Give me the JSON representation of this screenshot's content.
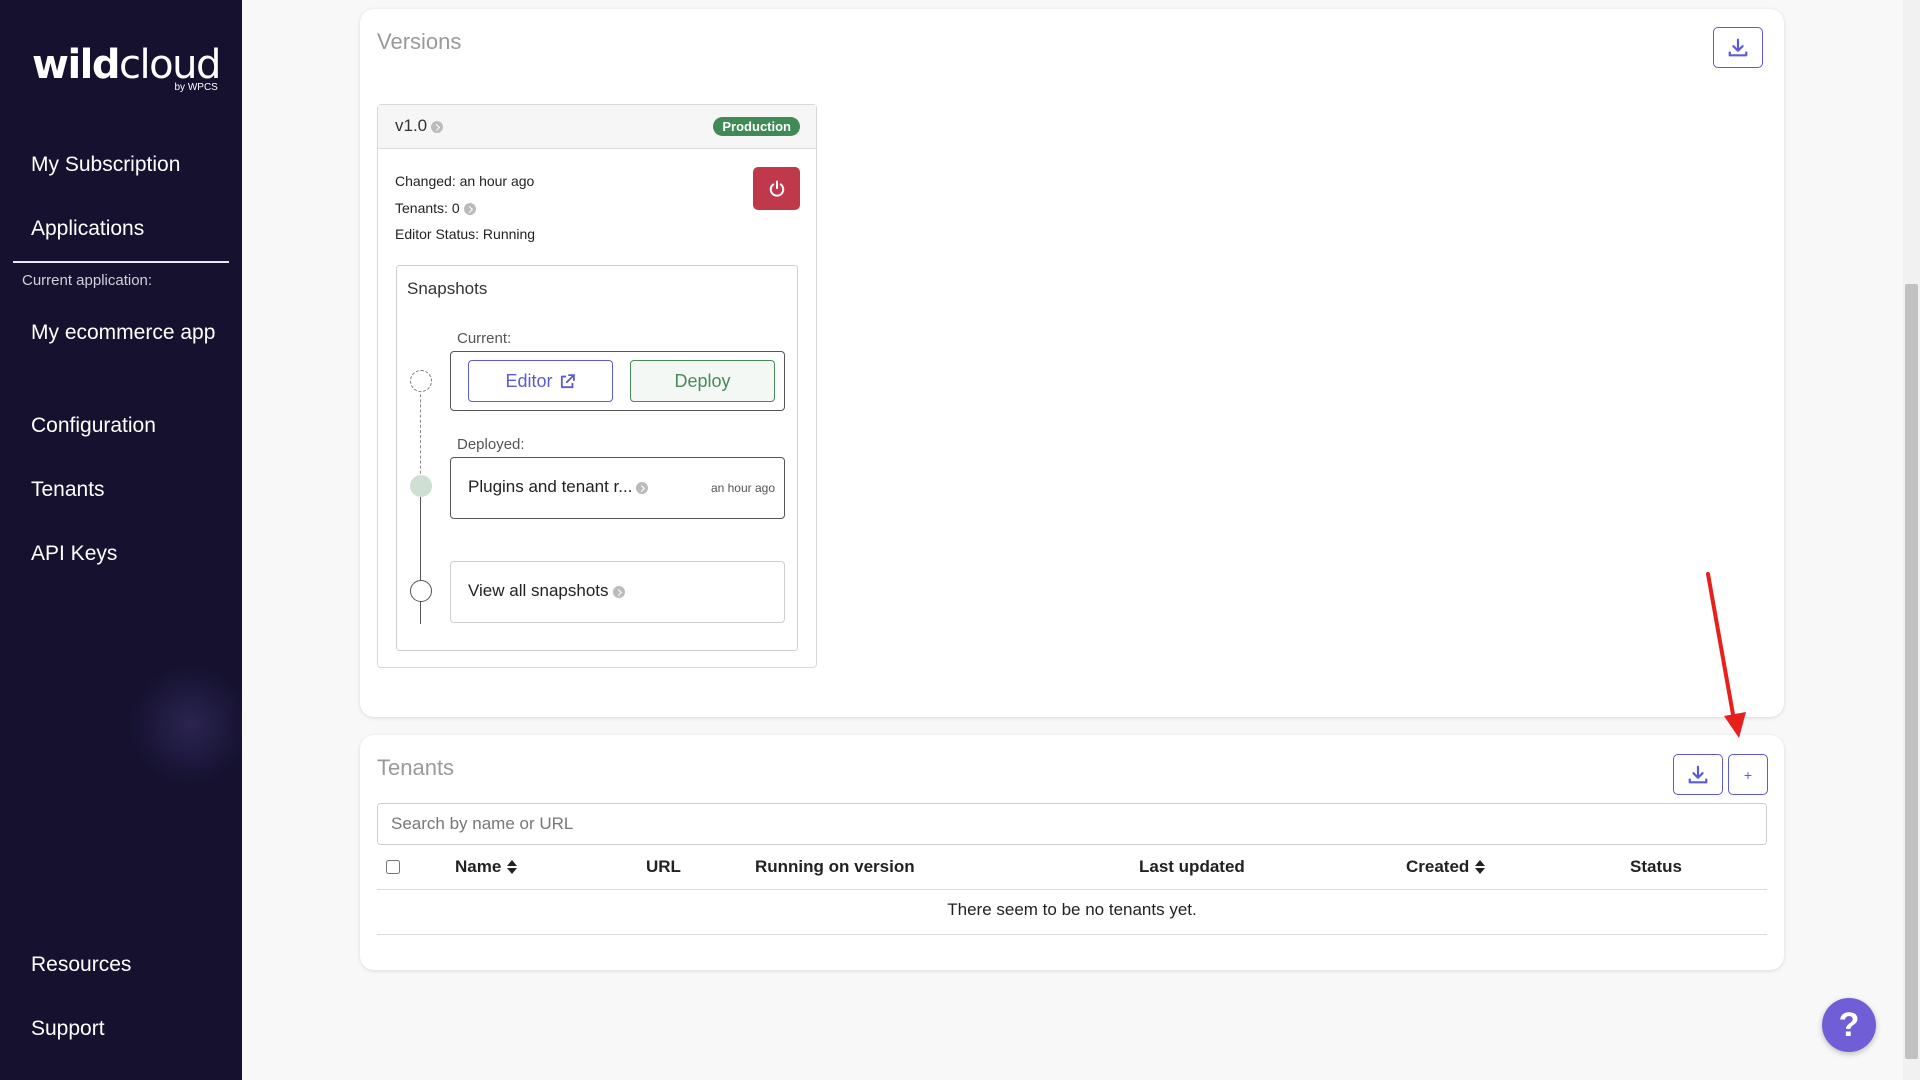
{
  "brand": {
    "name_bold": "wild",
    "name_light": "cloud",
    "byline": "by WPCS"
  },
  "sidebar": {
    "top_items": [
      {
        "label": "My Subscription"
      },
      {
        "label": "Applications"
      }
    ],
    "caption": "Current application:",
    "app_items": [
      {
        "label": "My ecommerce app"
      },
      {
        "label": "Configuration"
      },
      {
        "label": "Tenants"
      },
      {
        "label": "API Keys"
      }
    ],
    "bottom_items": [
      {
        "label": "Resources"
      },
      {
        "label": "Support"
      }
    ]
  },
  "versions": {
    "title": "Versions",
    "download_icon": "download-icon",
    "version": {
      "name": "v1.0",
      "badge": "Production",
      "changed": "Changed: an hour ago",
      "tenants": "Tenants: 0",
      "editor_status": "Editor Status: Running",
      "power_icon": "power-icon"
    },
    "snapshots": {
      "title": "Snapshots",
      "current_label": "Current:",
      "editor_label": "Editor",
      "deploy_label": "Deploy",
      "deployed_label": "Deployed:",
      "deployed_name": "Plugins and tenant r...",
      "deployed_time": "an hour ago",
      "view_all": "View all snapshots"
    }
  },
  "tenants": {
    "title": "Tenants",
    "add_label": "+",
    "search_placeholder": "Search by name or URL",
    "columns": [
      "Name",
      "URL",
      "Running on version",
      "Last updated",
      "Created",
      "Status"
    ],
    "empty_message": "There seem to be no tenants yet."
  },
  "help": {
    "label": "?"
  },
  "colors": {
    "sidebar_bg": "#15112f",
    "accent": "#5b5bd6",
    "production": "#3f8a55",
    "danger": "#c0394a",
    "annotation": "#e8201c"
  }
}
